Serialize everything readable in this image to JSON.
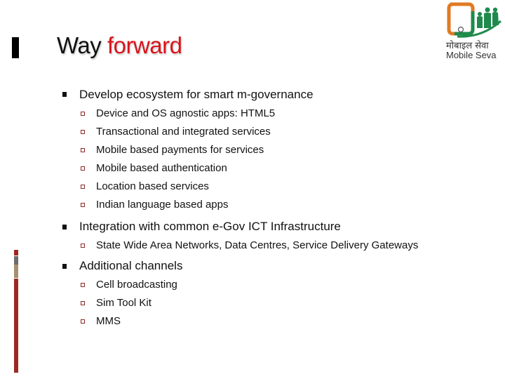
{
  "slide": {
    "title_part1": "Way",
    "title_part2": "forward",
    "colors": {
      "title_accent": "#d9131b",
      "bar_red": "#9c2a22",
      "bar_gray": "#6d6d6d",
      "bar_tan": "#a59170"
    }
  },
  "logo": {
    "icon": "mobile-seva-logo-icon",
    "text_hindi": "मोबाइल सेवा",
    "text_english": "Mobile Seva"
  },
  "sections": [
    {
      "label": "Develop ecosystem for smart m-governance",
      "items": [
        "Device and OS agnostic apps: HTML5",
        "Transactional and integrated services",
        "Mobile based payments for services",
        "Mobile based authentication",
        "Location based services",
        "Indian language based apps"
      ]
    },
    {
      "label": "Integration with common e-Gov ICT Infrastructure",
      "items": [
        "State Wide Area Networks, Data Centres, Service Delivery Gateways"
      ]
    },
    {
      "label": "Additional channels",
      "items": [
        "Cell broadcasting",
        "Sim Tool Kit",
        "MMS"
      ]
    }
  ]
}
